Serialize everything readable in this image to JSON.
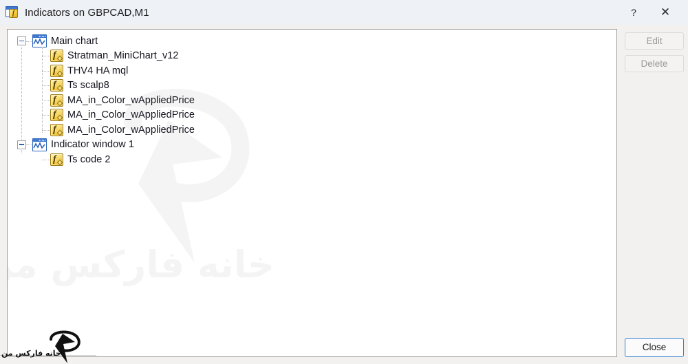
{
  "window": {
    "title": "Indicators on GBPCAD,M1",
    "icon": "indicator-window-icon",
    "help_label": "?",
    "close_label": "✕"
  },
  "tree": {
    "groups": [
      {
        "name": "Main chart",
        "icon": "chart-window-icon",
        "expanded": true,
        "children": [
          {
            "name": "Stratman_MiniChart_v12",
            "icon": "fx-indicator-icon"
          },
          {
            "name": "THV4 HA  mql",
            "icon": "fx-indicator-icon"
          },
          {
            "name": "Ts scalp8",
            "icon": "fx-indicator-icon"
          },
          {
            "name": "MA_in_Color_wAppliedPrice",
            "icon": "fx-indicator-icon"
          },
          {
            "name": "MA_in_Color_wAppliedPrice",
            "icon": "fx-indicator-icon"
          },
          {
            "name": "MA_in_Color_wAppliedPrice",
            "icon": "fx-indicator-icon"
          }
        ]
      },
      {
        "name": "Indicator window 1",
        "icon": "chart-window-icon",
        "expanded": true,
        "children": [
          {
            "name": "Ts code 2",
            "icon": "fx-indicator-icon"
          }
        ]
      }
    ]
  },
  "buttons": {
    "edit": "Edit",
    "delete": "Delete",
    "close": "Close"
  },
  "watermark": {
    "text": "خانه فارکس من",
    "brand_text": "خانه فارکس من"
  },
  "colors": {
    "titlebar": "#eef1f5",
    "dialog": "#f2f1ef",
    "panel": "#ffffff",
    "accent": "#2f7fd1",
    "icon_gold": "#f1c63c",
    "icon_blue": "#3f79cf"
  }
}
